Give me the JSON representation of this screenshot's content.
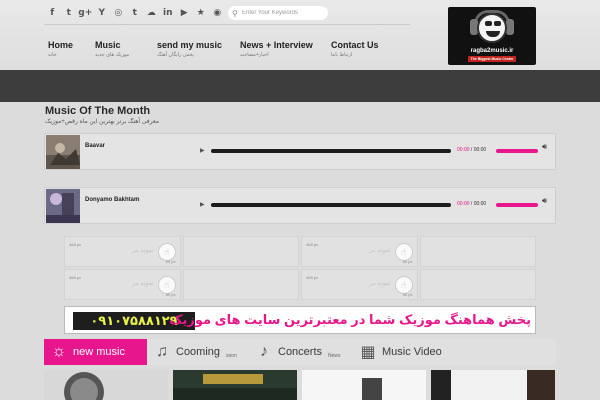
{
  "header": {
    "social_icons": [
      {
        "icon": "facebook-icon",
        "glyph": "f"
      },
      {
        "icon": "twitter-icon",
        "glyph": "t"
      },
      {
        "icon": "google-plus-icon",
        "glyph": "g+"
      },
      {
        "icon": "yahoo-icon",
        "glyph": "Y"
      },
      {
        "icon": "instagram-icon",
        "glyph": "◎"
      },
      {
        "icon": "tumblr-icon",
        "glyph": "t"
      },
      {
        "icon": "soundcloud-icon",
        "glyph": "☁"
      },
      {
        "icon": "linkedin-icon",
        "glyph": "in"
      },
      {
        "icon": "youtube-icon",
        "glyph": "▶"
      },
      {
        "icon": "star-icon",
        "glyph": "★"
      },
      {
        "icon": "rss-icon",
        "glyph": "◉"
      }
    ],
    "search": {
      "placeholder": "Enter Your Keywords"
    },
    "nav": [
      {
        "label": "Home",
        "sub": "خانه"
      },
      {
        "label": "Music",
        "sub": "موزیک های جدید"
      },
      {
        "label": "send my music",
        "sub": "پخش رایگان آهنگ"
      },
      {
        "label": "News + Interview",
        "sub": "اخبار+مصاحبه"
      },
      {
        "label": "Contact Us",
        "sub": "ارتباط باما"
      }
    ],
    "logo": {
      "site": "ragba2music.ir",
      "tagline": "The Biggest Music Center"
    }
  },
  "music_of_month": {
    "title": "Music Of The Month",
    "subtitle": "معرفی آهنگ برتر بهترین این ماه رقص+موزیک",
    "tracks": [
      {
        "title": "Baavar",
        "time_current": "00:00",
        "time_sep": " / ",
        "time_total": "00:00"
      },
      {
        "title": "Donyamo Bakhtam",
        "time_current": "00:00",
        "time_sep": " / ",
        "time_total": "00:00"
      }
    ]
  },
  "ads": {
    "cells": [
      {
        "text": "نمونه بنر",
        "size_w": "60 px",
        "size_h": "468 px"
      },
      {
        "text": "نمونه بنر",
        "size_w": "60 px",
        "size_h": "468 px"
      },
      {
        "text": "نمونه بنر",
        "size_w": "60 px",
        "size_h": "468 px"
      },
      {
        "text": "نمونه بنر",
        "size_w": "60 px",
        "size_h": "468 px"
      }
    ]
  },
  "banner": {
    "phone": "۰۹۱۰۷۵۸۸۱۲۹",
    "message": "پخش هماهنگ موزیک شما در معتبرترین سایت های موزیک"
  },
  "tabs": [
    {
      "label": "new music",
      "sub": "",
      "icon": "sun-icon",
      "active": true
    },
    {
      "label": "Cooming",
      "sub": "soon",
      "icon": "music-notes-icon",
      "active": false
    },
    {
      "label": "Concerts",
      "sub": "News",
      "icon": "music-note-icon",
      "active": false
    },
    {
      "label": "Music Video",
      "sub": "",
      "icon": "film-icon",
      "active": false
    }
  ],
  "colors": {
    "accent": "#e8168c",
    "dark_band": "#3d3d3d"
  }
}
